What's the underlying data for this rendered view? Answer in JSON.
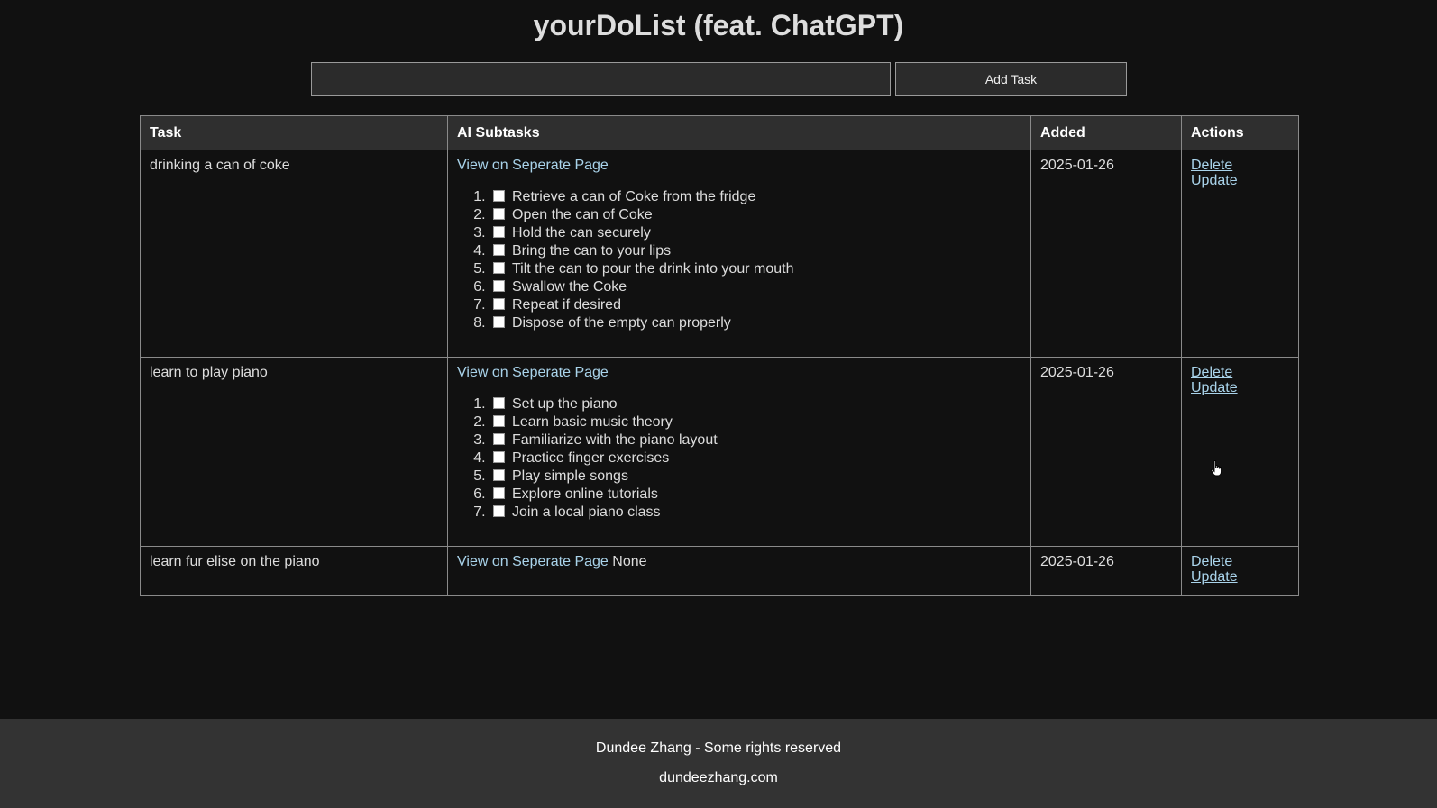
{
  "header": {
    "title": "yourDoList (feat. ChatGPT)"
  },
  "form": {
    "input_value": "",
    "add_label": "Add Task"
  },
  "table": {
    "columns": [
      "Task",
      "AI Subtasks",
      "Added",
      "Actions"
    ],
    "rows": [
      {
        "task": "drinking a can of coke",
        "link": "View on Seperate Page",
        "subtasks": [
          "Retrieve a can of Coke from the fridge",
          "Open the can of Coke",
          "Hold the can securely",
          "Bring the can to your lips",
          "Tilt the can to pour the drink into your mouth",
          "Swallow the Coke",
          "Repeat if desired",
          "Dispose of the empty can properly"
        ],
        "added": "2025-01-26",
        "delete": "Delete",
        "update": "Update"
      },
      {
        "task": "learn to play piano",
        "link": "View on Seperate Page",
        "subtasks": [
          "Set up the piano",
          "Learn basic music theory",
          "Familiarize with the piano layout",
          "Practice finger exercises",
          "Play simple songs",
          "Explore online tutorials",
          "Join a local piano class"
        ],
        "added": "2025-01-26",
        "delete": "Delete",
        "update": "Update"
      },
      {
        "task": "learn fur elise on the piano",
        "link": "View on Seperate Page",
        "none_text": "None",
        "added": "2025-01-26",
        "delete": "Delete",
        "update": "Update"
      }
    ]
  },
  "footer": {
    "line1": "Dundee Zhang - Some rights reserved",
    "line2": "dundeezhang.com"
  },
  "colors": {
    "background": "#111111",
    "link": "#a9d3ea",
    "footer_bg": "#333333"
  },
  "icons": {
    "cursor": "hand-pointer-icon"
  }
}
